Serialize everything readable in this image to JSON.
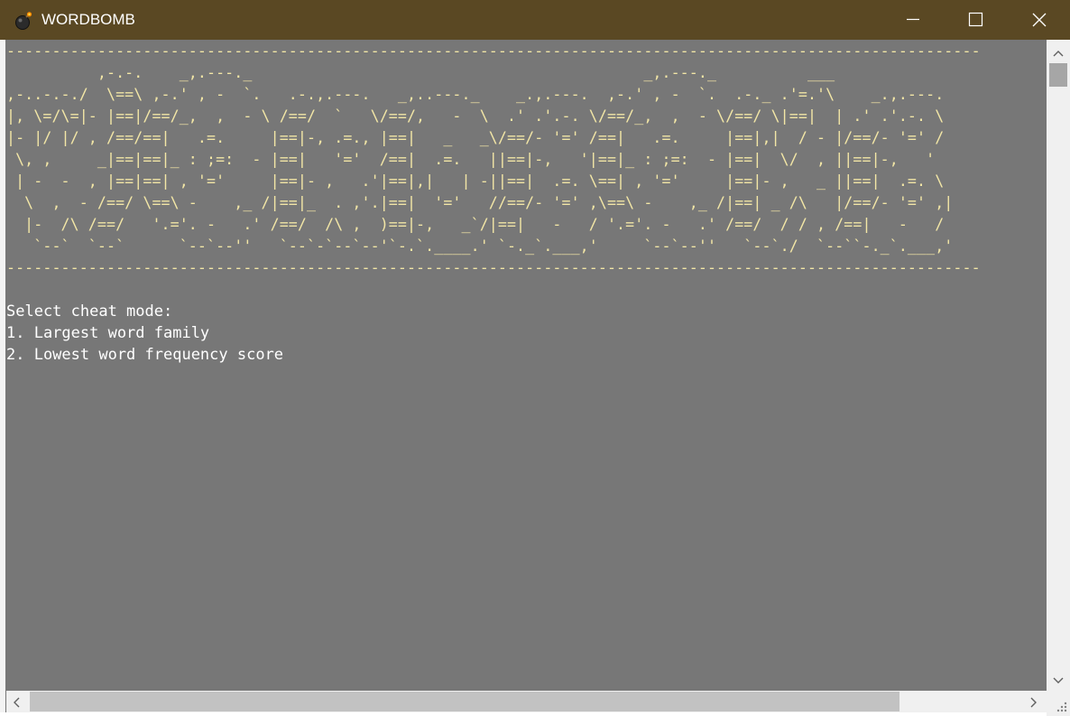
{
  "window": {
    "title": "WORDBOMB",
    "app_icon": "bomb-icon",
    "controls": {
      "minimize_icon": "minimize-icon",
      "maximize_icon": "maximize-icon",
      "close_icon": "close-icon"
    }
  },
  "console": {
    "banner_lines": [
      "-----------------------------------------------------------------------------------------------------------",
      "          ,-.-.    _,.---._                                           _,.---._          ___",
      ",-..-.-./  \\==\\ ,-.' , -  `.   .-.,.---.   _,..---._    _.,.---.  ,-.' , -  `.  .-._ .'=.'\\    _.,.---.",
      "|, \\=/\\=|- |==|/==/_,  ,  - \\ /==/  `   \\/==/,   -  \\  .' .'.-. \\/==/_,  ,  - \\/==/ \\|==|  | .' .'.-. \\",
      "|- |/ |/ , /==/==|   .=.     |==|-, .=., |==|   _   _\\/==/- '=' /==|   .=.     |==|,|  / - |/==/- '=' /",
      " \\, ,     _|==|==|_ : ;=:  - |==|   '='  /==|  .=.   ||==|-,   '|==|_ : ;=:  - |==|  \\/  , ||==|-,   '",
      " | -  -  , |==|==| , '='     |==|- ,   .'|==|,|   | -||==|  .=. \\==| , '='     |==|- ,   _ ||==|  .=. \\",
      "  \\  ,  - /==/ \\==\\ -    ,_ /|==|_  . ,'.|==|  '='   //==/- '=' ,\\==\\ -    ,_ /|==| _ /\\   |/==/- '=' ,|",
      "  |-  /\\ /==/   '.='. -   .' /==/  /\\ ,  )==|-,   _`/|==|   -   / '.='. -   .' /==/  / / , /==|   -   /",
      "   `--`  `--`      `--`--''   `--`-`--`--'`-.`.____.' `-._`.___,'     `--`--''   `--`./  `--``-._`.___,'",
      "-----------------------------------------------------------------------------------------------------------"
    ],
    "prompt": "Select cheat mode:",
    "options": [
      "1. Largest word family",
      "2. Lowest word frequency score"
    ]
  },
  "colors": {
    "titlebar_bg": "#5a4823",
    "console_bg": "#777777",
    "banner_text": "#f2e6a6",
    "menu_text": "#ffffff"
  }
}
